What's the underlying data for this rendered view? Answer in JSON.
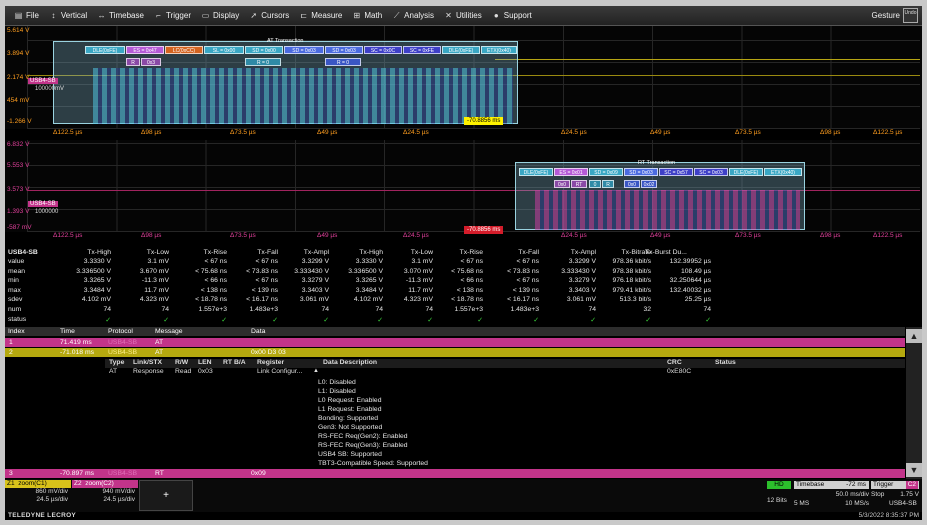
{
  "menu": [
    {
      "label": "File",
      "icon": "file-icon"
    },
    {
      "label": "Vertical",
      "icon": "vertical-icon"
    },
    {
      "label": "Timebase",
      "icon": "timebase-icon"
    },
    {
      "label": "Trigger",
      "icon": "trigger-icon"
    },
    {
      "label": "Display",
      "icon": "display-icon"
    },
    {
      "label": "Cursors",
      "icon": "cursors-icon"
    },
    {
      "label": "Measure",
      "icon": "measure-icon"
    },
    {
      "label": "Math",
      "icon": "math-icon"
    },
    {
      "label": "Analysis",
      "icon": "analysis-icon"
    },
    {
      "label": "Utilities",
      "icon": "utilities-icon"
    },
    {
      "label": "Support",
      "icon": "support-icon"
    }
  ],
  "gesture_label": "Gesture",
  "gesture_box": "Undo",
  "top_panel": {
    "ylabels": [
      "5.614 V",
      "3.894 V",
      "2.174 V",
      "454 mV",
      "-1.266 V"
    ],
    "xlabels": [
      "Δ122.5 µs",
      "Δ98 µs",
      "Δ73.5 µs",
      "Δ49 µs",
      "Δ24.5 µs",
      "Δ24.5 µs",
      "Δ49 µs",
      "Δ73.5 µs",
      "Δ98 µs",
      "Δ122.5 µs"
    ],
    "transaction_title": "AT Transaction",
    "channel_tag": "USB4-SB",
    "channel_sub": "100000mV",
    "segments_top": [
      "DLE(0xFE)",
      "ES = 0x47",
      "LC(0xCC)",
      "SL = 0x00",
      "SD = 0x00",
      "SD = 0x03",
      "SD = 0x03",
      "SC = 0x0C",
      "SC = 0xFE",
      "DLE(0xFE)",
      "ETX(0x40)"
    ],
    "segments_mid": [
      "R",
      "0x3",
      "",
      "R = 0",
      "",
      "R = 0",
      "",
      "",
      "",
      "",
      ""
    ],
    "cursor_label": "-70.8856 ms"
  },
  "bottom_panel": {
    "ylabels": [
      "6.832 V",
      "5.553 V",
      "3.573 V",
      "1.393 V",
      "-587 mV"
    ],
    "xlabels": [
      "Δ122.5 µs",
      "Δ98 µs",
      "Δ73.5 µs",
      "Δ49 µs",
      "Δ24.5 µs",
      "Δ24.5 µs",
      "Δ49 µs",
      "Δ73.5 µs",
      "Δ98 µs",
      "Δ122.5 µs"
    ],
    "transaction_title": "RT Transaction",
    "channel_tag": "USB4-SB",
    "channel_sub": "1000000",
    "segments_top": [
      "DLE(0xFE)",
      "ES = 0x01",
      "SD = 0x09",
      "SD = 0x03",
      "SC = 0x57",
      "SC = 0x03",
      "DLE(0xFE)",
      "ETX(0x40)"
    ],
    "segments_mid": [
      "0x0",
      "RT",
      "0",
      "R",
      "0x0",
      "0x02"
    ],
    "cursor_label": "-70.8856 ms"
  },
  "params": {
    "source": "USB4-SB",
    "columns": [
      "Tx-High",
      "Tx-Low",
      "Tx-Rise",
      "Tx-Fall",
      "Tx-Ampl",
      "Tx-High",
      "Tx-Low",
      "Tx-Rise",
      "Tx-Fall",
      "Tx-Ampl",
      "Tx-Bitrate",
      "Tx-Burst Du..."
    ],
    "rows": [
      {
        "name": "value",
        "cells": [
          "3.3330 V",
          "3.1 mV",
          "< 67 ns",
          "< 67 ns",
          "3.3299 V",
          "3.3330 V",
          "3.1 mV",
          "< 67 ns",
          "< 67 ns",
          "3.3299 V",
          "978.36 kbit/s",
          "132.39952 µs"
        ]
      },
      {
        "name": "mean",
        "cells": [
          "3.336500 V",
          "3.670 mV",
          "< 75.68 ns",
          "< 73.83 ns",
          "3.333430 V",
          "3.336500 V",
          "3.070 mV",
          "< 75.68 ns",
          "< 73.83 ns",
          "3.333430 V",
          "978.38 kbit/s",
          "108.49 µs"
        ]
      },
      {
        "name": "min",
        "cells": [
          "3.3265 V",
          "-11.3 mV",
          "< 66 ns",
          "< 67 ns",
          "3.3279 V",
          "3.3265 V",
          "-11.3 mV",
          "< 66 ns",
          "< 67 ns",
          "3.3279 V",
          "976.18 kbit/s",
          "32.250644 µs"
        ]
      },
      {
        "name": "max",
        "cells": [
          "3.3484 V",
          "11.7 mV",
          "< 138 ns",
          "< 139 ns",
          "3.3403 V",
          "3.3484 V",
          "11.7 mV",
          "< 138 ns",
          "< 139 ns",
          "3.3403 V",
          "979.41 kbit/s",
          "132.40032 µs"
        ]
      },
      {
        "name": "sdev",
        "cells": [
          "4.102 mV",
          "4.323 mV",
          "< 18.78 ns",
          "< 16.17 ns",
          "3.061 mV",
          "4.102 mV",
          "4.323 mV",
          "< 18.78 ns",
          "< 16.17 ns",
          "3.061 mV",
          "513.3 bit/s",
          "25.25 µs"
        ]
      },
      {
        "name": "num",
        "cells": [
          "74",
          "74",
          "1.557e+3",
          "1.483e+3",
          "74",
          "74",
          "74",
          "1.557e+3",
          "1.483e+3",
          "74",
          "32",
          "74"
        ]
      },
      {
        "name": "status",
        "cells": [
          "✓",
          "✓",
          "✓",
          "✓",
          "✓",
          "✓",
          "✓",
          "✓",
          "✓",
          "✓",
          "✓",
          "✓"
        ]
      }
    ]
  },
  "decode": {
    "headers": [
      "Index",
      "Time",
      "Protocol",
      "Message",
      "Data"
    ],
    "rows": [
      {
        "index": "1",
        "time": "71.419 ms",
        "protocol": "USB4-SB",
        "message": "AT",
        "data": ""
      },
      {
        "index": "2",
        "time": "-71.018 ms",
        "protocol": "USB4-SB",
        "message": "AT",
        "data": "0x00 D3 03"
      }
    ],
    "sub_headers": [
      "Type",
      "Link/STX",
      "R/W",
      "LEN",
      "RT B/A",
      "Register",
      "Data Description",
      "CRC",
      "Status"
    ],
    "sub_values": [
      "AT",
      "Response",
      "Read",
      "0x03",
      "",
      "Link Configur...",
      "",
      "0xE80C",
      ""
    ],
    "descriptions": [
      "L0: Disabled",
      "L1: Disabled",
      "L0 Request: Enabled",
      "L1 Request: Enabled",
      "Bonding: Supported",
      "Gen3: Not Supported",
      "RS-FEC Req(Gen2): Enabled",
      "RS-FEC Req(Gen3): Enabled",
      "USB4 SB: Supported",
      "TBT3-Compatible Speed: Supported"
    ],
    "last_row": {
      "index": "3",
      "time": "-70.897 ms",
      "protocol": "USB4-SB",
      "message": "RT",
      "data": "0x09"
    }
  },
  "status": {
    "z1": {
      "head": "Z1",
      "sub": "zoom(C1)",
      "l1": "860 mV/div",
      "l2": "24.5 µs/div"
    },
    "z2": {
      "head": "Z2",
      "sub": "zoom(C2)",
      "l1": "940 mV/div",
      "l2": "24.5 µs/div"
    },
    "plus": "+",
    "hd": "HD",
    "bits": "12 Bits",
    "timebase_label": "Timebase",
    "timebase_val": "-72 ms",
    "timebase_div": "50.0 ms/div",
    "sample_pts": "5 MS",
    "sample_rate": "10 MS/s",
    "trigger_label": "Trigger",
    "trigger_ch": "C2",
    "trigger_mode": "Stop",
    "trigger_level": "1.75 V",
    "trigger_src": "USB4-SB"
  },
  "brand": "TELEDYNE LECROY",
  "datetime": "5/3/2022 8:35:37 PM",
  "colors": {
    "ch1": "#ff9e1f",
    "ch2": "#e0409a",
    "cursor": "#fff200"
  }
}
